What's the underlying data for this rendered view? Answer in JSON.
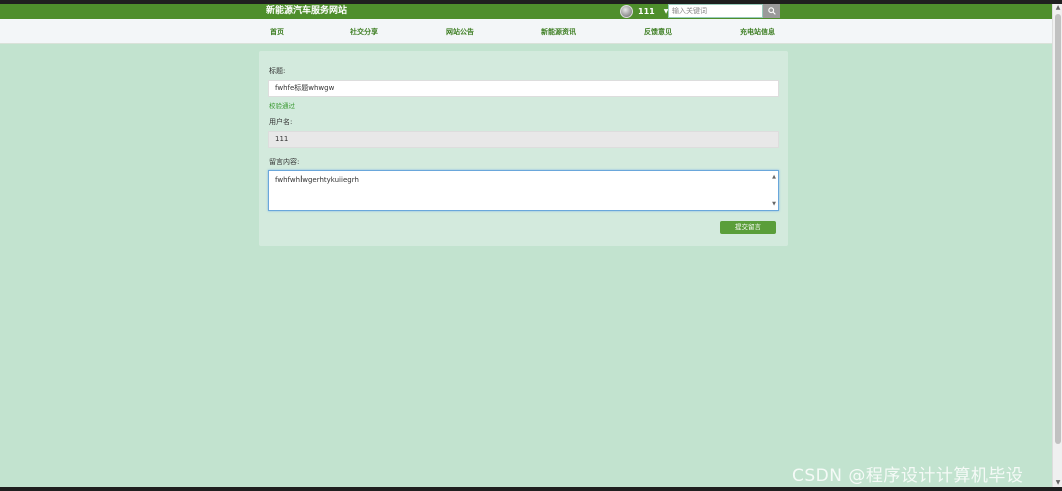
{
  "header": {
    "site_title": "新能源汽车服务网站",
    "username": "111",
    "search_placeholder": "输入关键词"
  },
  "nav": {
    "items": [
      {
        "label": "首页"
      },
      {
        "label": "社交分享"
      },
      {
        "label": "网站公告"
      },
      {
        "label": "新能源资讯"
      },
      {
        "label": "反馈意见"
      },
      {
        "label": "充电站信息"
      }
    ]
  },
  "form": {
    "title_label": "标题:",
    "title_value": "fwhfe标题whwgw",
    "title_valid": "校验通过",
    "username_label": "用户名:",
    "username_value": "111",
    "content_label": "留言内容:",
    "content_value": "fwhfwh wgerhtykuiiegrh",
    "submit_label": "提交留言"
  },
  "watermark": "CSDN @程序设计计算机毕设",
  "colors": {
    "topbar": "#4e8e2c",
    "nav_text": "#3d7e22",
    "page_bg": "#c2e3cf",
    "panel_bg": "#d3eadd",
    "submit": "#5a9e3a",
    "valid": "#3b9a32"
  }
}
